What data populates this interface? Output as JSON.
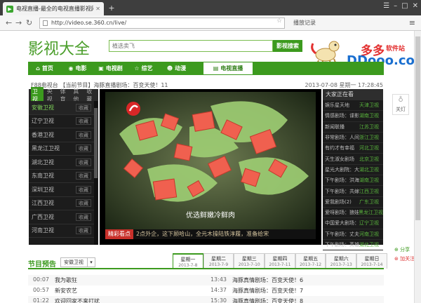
{
  "browser": {
    "tab_title": "电视直播-最全的电视直播影视网",
    "url": "http://video.se.360.cn/live/",
    "history_label": "播放记录"
  },
  "site": {
    "logo": "影视大全",
    "search_placeholder": "植选卖飞",
    "search_button": "影视搜索"
  },
  "watermark": {
    "cn": "多多",
    "cn_small": "软件站",
    "url": "DDooo.com"
  },
  "nav": [
    {
      "label": "首页",
      "icon": "home-icon",
      "glyph": "⌂"
    },
    {
      "label": "电影",
      "icon": "film-icon",
      "glyph": "◉"
    },
    {
      "label": "电视剧",
      "icon": "tv-icon",
      "glyph": "▣"
    },
    {
      "label": "综艺",
      "icon": "star-icon",
      "glyph": "☆"
    },
    {
      "label": "动漫",
      "icon": "anime-icon",
      "glyph": "☻"
    },
    {
      "label": "电视直播",
      "icon": "live-icon",
      "glyph": "▤"
    }
  ],
  "ticker": {
    "text": "F88电视台 【当前节目】海豚直播剧场：百变天使！11",
    "date": "2013-07-08 星期一 17:28:45"
  },
  "channel_tabs": [
    "卫视",
    "央视",
    "体育",
    "其他",
    "收藏"
  ],
  "channels": [
    {
      "name": "安徽卫视",
      "action": "收藏"
    },
    {
      "name": "辽宁卫视",
      "action": "收藏"
    },
    {
      "name": "香港卫视",
      "action": "收藏"
    },
    {
      "name": "黑龙江卫视",
      "action": "收藏"
    },
    {
      "name": "湖北卫视",
      "action": "收藏"
    },
    {
      "name": "东南卫视",
      "action": "收藏"
    },
    {
      "name": "深圳卫视",
      "action": "收藏"
    },
    {
      "name": "江西卫视",
      "action": "收藏"
    },
    {
      "name": "广西卫视",
      "action": "收藏"
    },
    {
      "name": "河南卫视",
      "action": "收藏"
    }
  ],
  "player": {
    "caption": "优选鲜嫩冷鲜肉",
    "highlight_badge": "精彩看点",
    "highlight_text": "2点外企，这下顾哈山，全元木操陆铁淳履，准备给宋"
  },
  "now_playing": {
    "header": "大家正在看",
    "rows": [
      {
        "program": "娱乐星天地",
        "channel": "天津卫视"
      },
      {
        "program": "情感剧场：谍影",
        "channel": "湖南卫视"
      },
      {
        "program": "新闻联播",
        "channel": "江苏卫视"
      },
      {
        "program": "非常剧场：人间",
        "channel": "浙江卫视"
      },
      {
        "program": "有约才有幸福",
        "channel": "河北卫视"
      },
      {
        "program": "天生淑女剧场",
        "channel": "北京卫视"
      },
      {
        "program": "星光大剧院：大",
        "channel": "湖北卫视"
      },
      {
        "program": "下午剧场：洪海",
        "channel": "湖南卫视"
      },
      {
        "program": "下午剧场：共嫁",
        "channel": "江西卫视"
      },
      {
        "program": "爱我剧场(2)",
        "channel": "广东卫视"
      },
      {
        "program": "爱呀剧场：狼娃",
        "channel": "黑龙江卫视"
      },
      {
        "program": "中国爱大剧场：",
        "channel": "辽宁卫视"
      },
      {
        "program": "下午剧场：丈夫",
        "channel": "河南卫视"
      },
      {
        "program": "下午剧场：英雄",
        "channel": "湖北卫视"
      }
    ]
  },
  "side_tool": {
    "label": "关灯"
  },
  "schedule": {
    "title": "节目预告",
    "selected_channel": "安徽卫视",
    "days": [
      {
        "name": "星期一",
        "date": "2013-7-8"
      },
      {
        "name": "星期二",
        "date": "2013-7-9"
      },
      {
        "name": "星期三",
        "date": "2013-7-10"
      },
      {
        "name": "星期四",
        "date": "2013-7-11"
      },
      {
        "name": "星期五",
        "date": "2013-7-12"
      },
      {
        "name": "星期六",
        "date": "2013-7-13"
      },
      {
        "name": "星期日",
        "date": "2013-7-14"
      }
    ],
    "rows": [
      {
        "t1": "00:07",
        "p1": "我为歌狂",
        "t2": "13:43",
        "p2": "海豚真情剧场：百变天使！6"
      },
      {
        "t1": "00:57",
        "p1": "新安农艺",
        "t2": "14:37",
        "p2": "海豚真情剧场：百变天使！7"
      },
      {
        "t1": "01:22",
        "p1": "欢迎回家不来打扰",
        "t2": "15:30",
        "p2": "海豚真情剧场：百变天使！8"
      }
    ]
  },
  "float": {
    "share": "分享",
    "follow": "加关注"
  }
}
